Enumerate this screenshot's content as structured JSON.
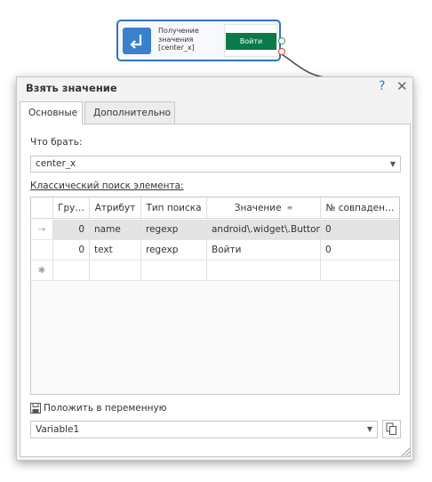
{
  "node": {
    "title_lines": [
      "Получение",
      "значения",
      "[center_x]"
    ],
    "preview_button_label": "Войти",
    "accent_color": "#3a80cf",
    "preview_button_color": "#0a7a4a"
  },
  "dialog": {
    "title": "Взять значение",
    "help_glyph": "?",
    "close_glyph": "✕",
    "tabs": [
      "Основные",
      "Дополнительно"
    ],
    "active_tab": "Основные",
    "what_label": "Что брать:",
    "what_value": "center_x",
    "search_label": "Классический поиск элемента:",
    "grid": {
      "columns": [
        "",
        "Гру…",
        "Атрибут",
        "Тип поиска",
        "Значение",
        "№ совпаден…"
      ],
      "rows": [
        {
          "marker": "→",
          "group": "0",
          "attribute": "name",
          "search_type": "regexp",
          "value": "android\\.widget\\.Button",
          "match": "0",
          "selected": true
        },
        {
          "marker": "",
          "group": "0",
          "attribute": "text",
          "search_type": "regexp",
          "value": "Войти",
          "match": "0",
          "selected": false
        },
        {
          "marker": "✱",
          "group": "",
          "attribute": "",
          "search_type": "",
          "value": "",
          "match": "",
          "selected": false
        }
      ]
    },
    "variable_label": "Положить в переменную",
    "variable_value": "Variable1"
  },
  "icons": {
    "node_icon": "arrow-down-left-icon",
    "save_icon": "floppy-disk-icon",
    "copy_icon": "copy-icon",
    "dropdown": "chevron-down-icon"
  }
}
